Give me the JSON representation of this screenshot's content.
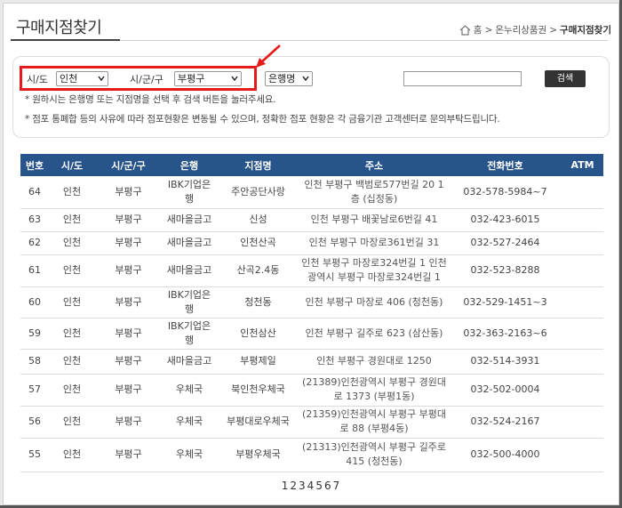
{
  "title": "구매지점찾기",
  "breadcrumb": {
    "home": "홈",
    "sep": ">",
    "level1": "온누리상품권",
    "current": "구매지점찾기"
  },
  "search": {
    "sido_label": "시/도",
    "sido_value": "인천",
    "sigungu_label": "시/군/구",
    "sigungu_value": "부평구",
    "bank_value": "은행명",
    "keyword_value": "",
    "button_label": "검색",
    "note1": "* 원하시는 은행명 또는 지점명을 선택 후 검색 버튼을 눌러주세요.",
    "note2": "* 점포 통폐합 등의 사유에 따라 점포현황은 변동될 수 있으며, 정확한 점포 현황은 각 금융기관 고객센터로 문의부탁드립니다."
  },
  "table": {
    "headers": [
      "번호",
      "시/도",
      "시/군/구",
      "은행",
      "지점명",
      "주소",
      "전화번호",
      "ATM"
    ],
    "rows": [
      [
        "64",
        "인천",
        "부평구",
        "IBK기업은행",
        "주안공단사랑",
        "인천 부평구 백범로577번길 20 1층 (십정동)",
        "032-578-5984~7",
        ""
      ],
      [
        "63",
        "인천",
        "부평구",
        "새마을금고",
        "신성",
        "인천 부평구 배꽃남로6번길 41",
        "032-423-6015",
        ""
      ],
      [
        "62",
        "인천",
        "부평구",
        "새마을금고",
        "인천산곡",
        "인천 부평구 마장로361번길 31",
        "032-527-2464",
        ""
      ],
      [
        "61",
        "인천",
        "부평구",
        "새마을금고",
        "산곡2.4동",
        "인천 부평구 마장로324번길 1 인천광역시 부평구 마장로324번길 1",
        "032-523-8288",
        ""
      ],
      [
        "60",
        "인천",
        "부평구",
        "IBK기업은행",
        "청천동",
        "인천 부평구 마장로 406 (청천동)",
        "032-529-1451~3",
        ""
      ],
      [
        "59",
        "인천",
        "부평구",
        "IBK기업은행",
        "인천삼산",
        "인천 부평구 길주로 623 (삼산동)",
        "032-363-2163~6",
        ""
      ],
      [
        "58",
        "인천",
        "부평구",
        "새마을금고",
        "부평제일",
        "인천 부평구 경원대로 1250",
        "032-514-3931",
        ""
      ],
      [
        "57",
        "인천",
        "부평구",
        "우체국",
        "북인천우체국",
        "(21389)인천광역시 부평구 경원대로 1373 (부평1동)",
        "032-502-0004",
        ""
      ],
      [
        "56",
        "인천",
        "부평구",
        "우체국",
        "부평대로우체국",
        "(21359)인천광역시 부평구 부평대로 88 (부평4동)",
        "032-524-2167",
        ""
      ],
      [
        "55",
        "인천",
        "부평구",
        "우체국",
        "부평우체국",
        "(21313)인천광역시 부평구 길주로 415 (청천동)",
        "032-500-4000",
        ""
      ]
    ]
  },
  "pagination": [
    "1",
    "2",
    "3",
    "4",
    "5",
    "6",
    "7"
  ],
  "colors": {
    "header_bg": "#27548a",
    "highlight": "#e51b1b",
    "button_bg": "#333333"
  },
  "icons": {
    "home": "home-icon",
    "dropdown": "chevron-down-icon",
    "annotation": "red-arrow-icon"
  }
}
